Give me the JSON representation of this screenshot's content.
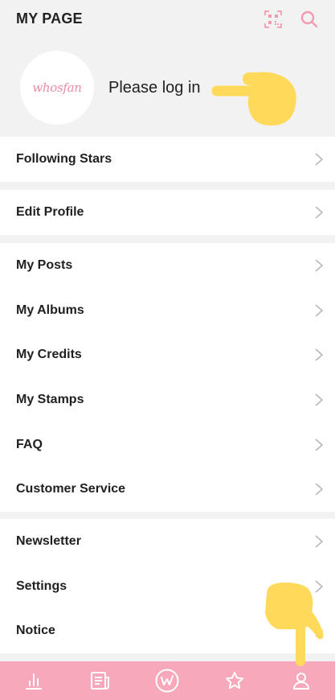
{
  "header": {
    "title": "MY PAGE",
    "icons": [
      "qr-code-icon",
      "search-icon"
    ],
    "accent_color": "#f7a9bb"
  },
  "profile": {
    "logo_text": "whosfan",
    "login_prompt": "Please log in"
  },
  "menu": {
    "group1": [
      {
        "label": "Following Stars"
      }
    ],
    "group2": [
      {
        "label": "Edit Profile"
      }
    ],
    "group3": [
      {
        "label": "My Posts"
      },
      {
        "label": "My Albums"
      },
      {
        "label": "My Credits"
      },
      {
        "label": "My Stamps"
      },
      {
        "label": "FAQ"
      },
      {
        "label": "Customer Service"
      }
    ],
    "group4": [
      {
        "label": "Newsletter"
      },
      {
        "label": "Settings"
      },
      {
        "label": "Notice"
      }
    ]
  },
  "bottom_nav": {
    "tabs": [
      {
        "icon": "chart-icon"
      },
      {
        "icon": "news-icon"
      },
      {
        "icon": "whosfan-w-icon"
      },
      {
        "icon": "star-icon"
      },
      {
        "icon": "person-icon"
      }
    ],
    "background": "#f7a9bb"
  },
  "overlay": {
    "pointer_color": "#ffd95a"
  }
}
